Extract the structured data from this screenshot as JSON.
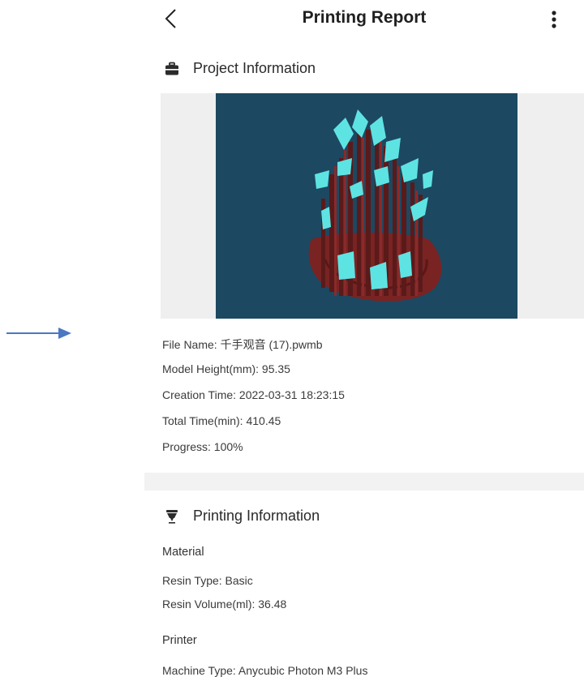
{
  "header": {
    "title": "Printing Report",
    "back_icon": "chevron-left-icon",
    "more_icon": "more-vertical-icon"
  },
  "project": {
    "heading": "Project Information",
    "icon": "toolbox-icon",
    "preview_colors": {
      "background": "#1d4861",
      "model": "#5ee3e3",
      "supports": "#7a2323"
    },
    "fields": [
      "File Name: 千手观音 (17).pwmb",
      "Model Height(mm): 95.35",
      "Creation Time: 2022-03-31 18:23:15",
      "Total Time(min): 410.45",
      "Progress: 100%"
    ]
  },
  "printing": {
    "heading": "Printing Information",
    "icon": "printer-nozzle-icon",
    "material": {
      "title": "Material",
      "fields": [
        "Resin Type: Basic",
        "Resin Volume(ml): 36.48"
      ]
    },
    "printer": {
      "title": "Printer",
      "fields": [
        "Machine Type: Anycubic Photon M3 Plus"
      ]
    }
  },
  "annotation": {
    "arrow_color": "#4a78c2"
  }
}
